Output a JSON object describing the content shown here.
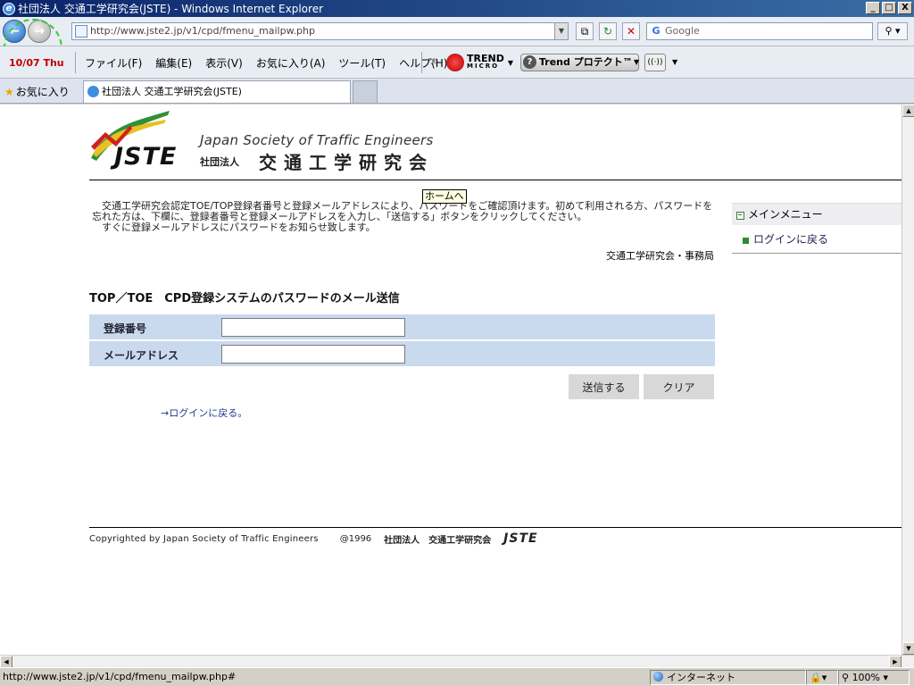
{
  "window": {
    "title": "社団法人 交通工学研究会(JSTE) - Windows Internet Explorer",
    "minimize": "_",
    "maximize": "□",
    "close": "X"
  },
  "address_bar": {
    "url": "http://www.jste2.jp/v1/cpd/fmenu_mailpw.php",
    "search_placeholder": "Google"
  },
  "menu_bar": {
    "date_badge": "10/07 Thu",
    "items": [
      "ファイル(F)",
      "編集(E)",
      "表示(V)",
      "お気に入り(A)",
      "ツール(T)",
      "ヘルプ(H)"
    ],
    "trend_label": "TREND",
    "trend_sub": "MICRO",
    "protect_label": "Trend プロテクト™"
  },
  "favorites_bar": {
    "favorites_label": "お気に入り",
    "tab_title": "社団法人 交通工学研究会(JSTE)"
  },
  "page": {
    "logo": {
      "en_name": "Japan Society of Traffic Engineers",
      "abbr": "JSTE",
      "small": "社団法人",
      "jp_name": "交通工学研究会"
    },
    "tooltip": "ホームへ",
    "intro_lines": [
      "　交通工学研究会認定TOE/TOP登録者番号と登録メールアドレスにより、パスワードをご確認頂けます。初めて利用される方、パスワードを",
      "忘れた方は、下欄に、登録者番号と登録メールアドレスを入力し、「送信する」ボタンをクリックしてください。",
      "　すぐに登録メールアドレスにパスワードをお知らせ致します。"
    ],
    "office": "交通工学研究会・事務局",
    "side_menu": {
      "head": "メインメニュー",
      "item": "ログインに戻る"
    },
    "form": {
      "title": "TOP／TOE　CPD登録システムのパスワードのメール送信",
      "reg_label": "登録番号",
      "reg_value": "",
      "mail_label": "メールアドレス",
      "mail_value": "",
      "submit": "送信する",
      "clear": "クリア"
    },
    "back_link": "→ログインに戻る。",
    "footer": {
      "copyright": "Copyrighted by Japan Society of Traffic Engineers",
      "year": "@1996",
      "org": "社団法人　交通工学研究会",
      "abbr": "JSTE"
    }
  },
  "status_bar": {
    "url": "http://www.jste2.jp/v1/cpd/fmenu_mailpw.php#",
    "zone": "インターネット",
    "zoom": "100%"
  },
  "colors": {
    "form_row": "#c9d9ee",
    "side_bullet": "#2e8b2e",
    "link": "#1a3a8a"
  }
}
